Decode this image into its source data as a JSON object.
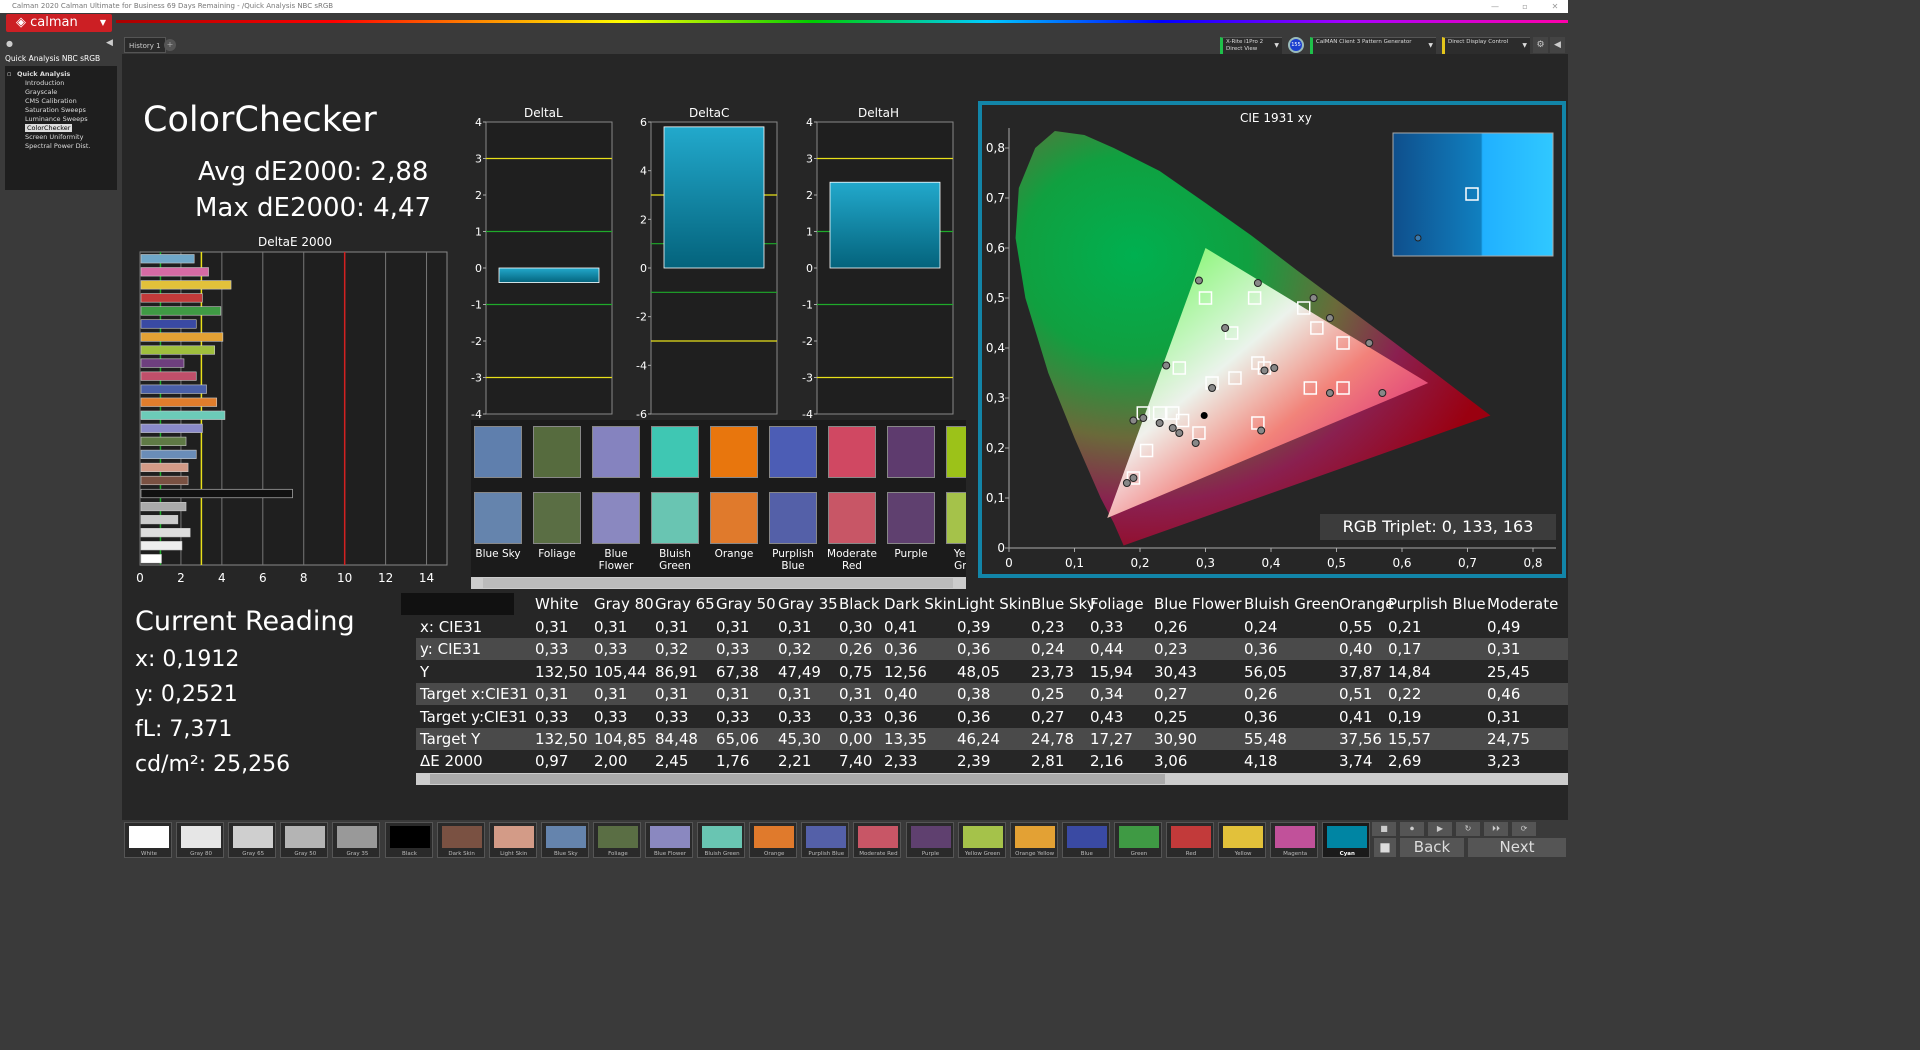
{
  "window": {
    "title": "Calman 2020 Calman Ultimate for Business 69 Days Remaining  - /Quick Analysis NBC sRGB"
  },
  "logo": {
    "text": "calman"
  },
  "sidebar": {
    "title": "Quick Analysis NBC sRGB",
    "items": [
      "Quick Analysis",
      "Introduction",
      "Grayscale",
      "CMS Calibration",
      "Saturation Sweeps",
      "Luminance Sweeps",
      "ColorChecker",
      "Screen Uniformity",
      "Spectral Power Dist."
    ],
    "selected": "ColorChecker"
  },
  "tabs": {
    "history": "History 1",
    "add": "+"
  },
  "devices": {
    "meter_line1": "X-Rite i1Pro 2",
    "meter_line2": "Direct View",
    "ring": "155",
    "pattern": "CalMAN Client 3 Pattern Generator",
    "display": "Direct Display Control"
  },
  "colorchecker": {
    "title": "ColorChecker",
    "avg": "Avg dE2000: 2,88",
    "max": "Max dE2000: 4,47"
  },
  "deltae": {
    "title": "DeltaE 2000",
    "xticks": [
      "0",
      "2",
      "4",
      "6",
      "8",
      "10",
      "12",
      "14"
    ],
    "bars": [
      {
        "v": 2.6,
        "c": "#6fa7c8"
      },
      {
        "v": 3.3,
        "c": "#d66aa4"
      },
      {
        "v": 4.4,
        "c": "#e2c13a"
      },
      {
        "v": 3.0,
        "c": "#c23a3a"
      },
      {
        "v": 3.9,
        "c": "#3f9a44"
      },
      {
        "v": 2.7,
        "c": "#3a4aa3"
      },
      {
        "v": 4.0,
        "c": "#e3a134"
      },
      {
        "v": 3.6,
        "c": "#9fbf3d"
      },
      {
        "v": 2.1,
        "c": "#6e3f7e"
      },
      {
        "v": 2.7,
        "c": "#c04f6a"
      },
      {
        "v": 3.2,
        "c": "#4a5fa8"
      },
      {
        "v": 3.7,
        "c": "#df7d2c"
      },
      {
        "v": 4.1,
        "c": "#6ccbb8"
      },
      {
        "v": 3.0,
        "c": "#8a8ac9"
      },
      {
        "v": 2.2,
        "c": "#5f7a45"
      },
      {
        "v": 2.7,
        "c": "#6a8db8"
      },
      {
        "v": 2.3,
        "c": "#d39b87"
      },
      {
        "v": 2.3,
        "c": "#7a5142"
      },
      {
        "v": 7.4,
        "c": "#111111"
      },
      {
        "v": 2.2,
        "c": "#aaaaaa"
      },
      {
        "v": 1.8,
        "c": "#cccccc"
      },
      {
        "v": 2.4,
        "c": "#dddddd"
      },
      {
        "v": 2.0,
        "c": "#eeeeee"
      },
      {
        "v": 1.0,
        "c": "#ffffff"
      }
    ]
  },
  "delta_charts": [
    {
      "title": "DeltaL",
      "yticks": [
        "4",
        "3",
        "2",
        "1",
        "0",
        "-1",
        "-2",
        "-3",
        "-4"
      ]
    },
    {
      "title": "DeltaC",
      "yticks": [
        "6",
        "4",
        "2",
        "0",
        "-2",
        "-4",
        "-6"
      ]
    },
    {
      "title": "DeltaH",
      "yticks": [
        "4",
        "3",
        "2",
        "1",
        "0",
        "-1",
        "-2",
        "-3",
        "-4"
      ]
    }
  ],
  "patches": [
    {
      "name": "Blue Sky",
      "top": "#5f7fad",
      "bot": "#6584ad"
    },
    {
      "name": "Foliage",
      "top": "#566b3e",
      "bot": "#5a6e44"
    },
    {
      "name": "Blue Flower",
      "top": "#8583bf",
      "bot": "#8a88c0"
    },
    {
      "name": "Bluish Green",
      "top": "#3fc7b3",
      "bot": "#69c5b2"
    },
    {
      "name": "Orange",
      "top": "#e8760d",
      "bot": "#e07a2c"
    },
    {
      "name": "Purplish Blue",
      "top": "#4c5db5",
      "bot": "#5460a8"
    },
    {
      "name": "Moderate Red",
      "top": "#d04862",
      "bot": "#c85666"
    },
    {
      "name": "Purple",
      "top": "#5e3b6e",
      "bot": "#5f406f"
    },
    {
      "name": "Yellow Green",
      "top": "#9cc219",
      "bot": "#a5c24a"
    }
  ],
  "cie": {
    "title": "CIE 1931 xy",
    "xticks": [
      "0",
      "0,1",
      "0,2",
      "0,3",
      "0,4",
      "0,5",
      "0,6",
      "0,7",
      "0,8"
    ],
    "yticks": [
      "0,8",
      "0,7",
      "0,6",
      "0,5",
      "0,4",
      "0,3",
      "0,2",
      "0,1",
      "0"
    ],
    "rgb_triplet": "RGB Triplet: 0, 133, 163"
  },
  "current_reading": {
    "title": "Current Reading",
    "x": "x: 0,1912",
    "y": "y: 0,2521",
    "fl": "fL: 7,371",
    "cdm2": "cd/m²: 25,256"
  },
  "table": {
    "headers": [
      "White",
      "Gray 80",
      "Gray 65",
      "Gray 50",
      "Gray 35",
      "Black",
      "Dark Skin",
      "Light Skin",
      "Blue Sky",
      "Foliage",
      "Blue Flower",
      "Bluish Green",
      "Orange",
      "Purplish Blue",
      "Moderate"
    ],
    "rows": [
      {
        "label": "x: CIE31",
        "values": [
          "0,31",
          "0,31",
          "0,31",
          "0,31",
          "0,31",
          "0,30",
          "0,41",
          "0,39",
          "0,23",
          "0,33",
          "0,26",
          "0,24",
          "0,55",
          "0,21",
          "0,49"
        ]
      },
      {
        "label": "y: CIE31",
        "values": [
          "0,33",
          "0,33",
          "0,32",
          "0,33",
          "0,32",
          "0,26",
          "0,36",
          "0,36",
          "0,24",
          "0,44",
          "0,23",
          "0,36",
          "0,40",
          "0,17",
          "0,31"
        ]
      },
      {
        "label": "Y",
        "values": [
          "132,50",
          "105,44",
          "86,91",
          "67,38",
          "47,49",
          "0,75",
          "12,56",
          "48,05",
          "23,73",
          "15,94",
          "30,43",
          "56,05",
          "37,87",
          "14,84",
          "25,45"
        ]
      },
      {
        "label": "Target x:CIE31",
        "values": [
          "0,31",
          "0,31",
          "0,31",
          "0,31",
          "0,31",
          "0,31",
          "0,40",
          "0,38",
          "0,25",
          "0,34",
          "0,27",
          "0,26",
          "0,51",
          "0,22",
          "0,46"
        ]
      },
      {
        "label": "Target y:CIE31",
        "values": [
          "0,33",
          "0,33",
          "0,33",
          "0,33",
          "0,33",
          "0,33",
          "0,36",
          "0,36",
          "0,27",
          "0,43",
          "0,25",
          "0,36",
          "0,41",
          "0,19",
          "0,31"
        ]
      },
      {
        "label": "Target Y",
        "values": [
          "132,50",
          "104,85",
          "84,48",
          "65,06",
          "45,30",
          "0,00",
          "13,35",
          "46,24",
          "24,78",
          "17,27",
          "30,90",
          "55,48",
          "37,56",
          "15,57",
          "24,75"
        ]
      },
      {
        "label": "ΔE 2000",
        "values": [
          "0,97",
          "2,00",
          "2,45",
          "1,76",
          "2,21",
          "7,40",
          "2,33",
          "2,39",
          "2,81",
          "2,16",
          "3,06",
          "4,18",
          "3,74",
          "2,69",
          "3,23"
        ]
      }
    ]
  },
  "swatches": [
    {
      "name": "White",
      "c": "#ffffff"
    },
    {
      "name": "Gray 80",
      "c": "#e6e6e6"
    },
    {
      "name": "Gray 65",
      "c": "#cfcfcf"
    },
    {
      "name": "Gray 50",
      "c": "#b4b4b4"
    },
    {
      "name": "Gray 35",
      "c": "#999999"
    },
    {
      "name": "Black",
      "c": "#000000"
    },
    {
      "name": "Dark Skin",
      "c": "#7a5142"
    },
    {
      "name": "Light Skin",
      "c": "#d39b87"
    },
    {
      "name": "Blue Sky",
      "c": "#6584ad"
    },
    {
      "name": "Foliage",
      "c": "#5a6e44"
    },
    {
      "name": "Blue Flower",
      "c": "#8a88c0"
    },
    {
      "name": "Bluish Green",
      "c": "#69c5b2"
    },
    {
      "name": "Orange",
      "c": "#e07a2c"
    },
    {
      "name": "Purplish Blue",
      "c": "#5460a8"
    },
    {
      "name": "Moderate Red",
      "c": "#c85666"
    },
    {
      "name": "Purple",
      "c": "#5f406f"
    },
    {
      "name": "Yellow Green",
      "c": "#a5c24a"
    },
    {
      "name": "Orange Yellow",
      "c": "#e3a134"
    },
    {
      "name": "Blue",
      "c": "#3a4aa3"
    },
    {
      "name": "Green",
      "c": "#3f9a44"
    },
    {
      "name": "Red",
      "c": "#c23a3a"
    },
    {
      "name": "Yellow",
      "c": "#e2c13a"
    },
    {
      "name": "Magenta",
      "c": "#c1519a"
    },
    {
      "name": "Cyan",
      "c": "#0085a3"
    }
  ],
  "active_swatch": "Cyan",
  "nav": {
    "back": "Back",
    "next": "Next"
  }
}
